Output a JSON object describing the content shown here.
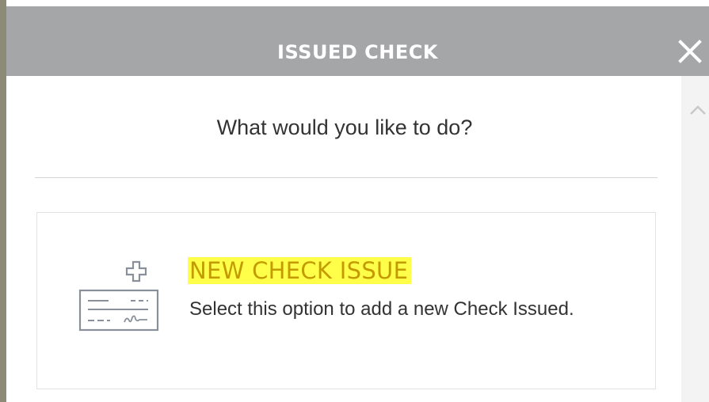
{
  "modal": {
    "title": "ISSUED CHECK",
    "close_icon": "close-icon",
    "accent_colors": {
      "header_bg": "#a5a6a8",
      "option_title": "#c39a00",
      "highlight": "#ffff4a"
    }
  },
  "content": {
    "question": "What would you like to do?",
    "options": [
      {
        "icon": "new-check-icon",
        "title": "NEW CHECK ISSUE",
        "description": "Select this option to add a new Check Issued."
      }
    ]
  },
  "scrollbar": {
    "up_icon": "chevron-up-icon"
  }
}
